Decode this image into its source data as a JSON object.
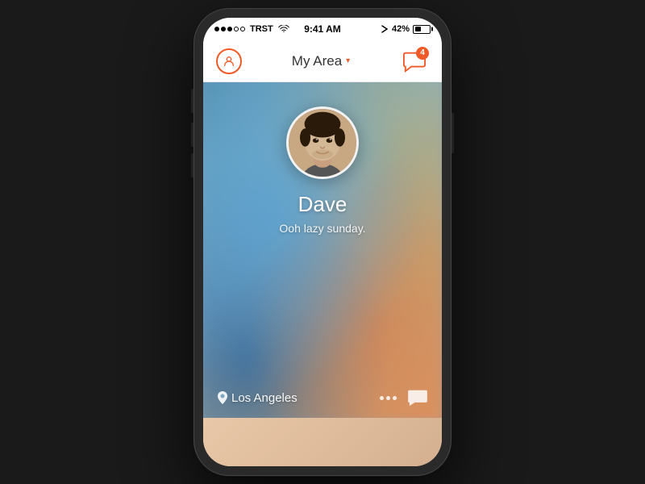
{
  "statusBar": {
    "signal": {
      "filled": 3,
      "empty": 2
    },
    "carrier": "TRST",
    "time": "9:41 AM",
    "bluetooth": "42%"
  },
  "navBar": {
    "title": "My Area",
    "chatBadge": "4"
  },
  "profile": {
    "name": "Dave",
    "status": "Ooh lazy sunday.",
    "location": "Los Angeles"
  },
  "icons": {
    "chevron": "▾",
    "locationPin": "📍",
    "chatBubble": "💬"
  }
}
